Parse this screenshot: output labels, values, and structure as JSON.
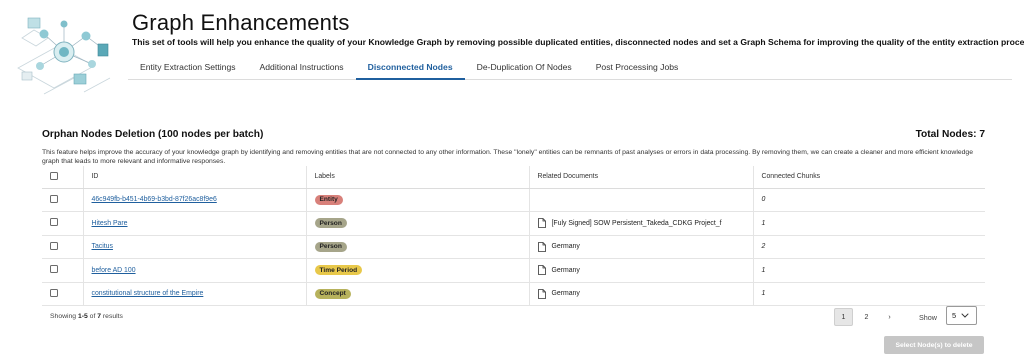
{
  "header": {
    "title": "Graph Enhancements",
    "subtitle": "This set of tools will help you enhance the quality of your Knowledge Graph by removing possible duplicated entities, disconnected nodes and set a Graph Schema for improving the quality of the entity extraction process"
  },
  "tabs": [
    {
      "label": "Entity Extraction Settings",
      "active": false
    },
    {
      "label": "Additional Instructions",
      "active": false
    },
    {
      "label": "Disconnected Nodes",
      "active": true
    },
    {
      "label": "De-Duplication Of Nodes",
      "active": false
    },
    {
      "label": "Post Processing Jobs",
      "active": false
    }
  ],
  "section": {
    "title": "Orphan Nodes Deletion (100 nodes per batch)",
    "total": "Total Nodes: 7",
    "description": "This feature helps improve the accuracy of your knowledge graph by identifying and removing entities that are not connected to any other information. These \"lonely\" entities can be remnants of past analyses or errors in data processing. By removing them, we can create a cleaner and more efficient knowledge graph that leads to more relevant and informative responses."
  },
  "table": {
    "headers": {
      "id": "ID",
      "labels": "Labels",
      "documents": "Related Documents",
      "chunks": "Connected Chunks"
    },
    "rows": [
      {
        "id": "46c949fb-b451-4b69-b3bd-87f26ac8f9e6",
        "label": "Entity",
        "label_color": "#d8807a",
        "document": "",
        "chunks": "0"
      },
      {
        "id": "Hitesh Pare",
        "label": "Person",
        "label_color": "#a6a58a",
        "document": "[Fuly Signed] SOW Persistent_Takeda_CDKG Project_f",
        "chunks": "1"
      },
      {
        "id": "Tacitus",
        "label": "Person",
        "label_color": "#a6a58a",
        "document": "Germany",
        "chunks": "2"
      },
      {
        "id": "before AD 100",
        "label": "Time Period",
        "label_color": "#e8c84a",
        "document": "Germany",
        "chunks": "1"
      },
      {
        "id": "constitutional structure of the Empire",
        "label": "Concept",
        "label_color": "#b7b25c",
        "document": "Germany",
        "chunks": "1"
      }
    ]
  },
  "footer": {
    "showing_prefix": "Showing ",
    "showing_range": "1-5",
    "showing_of": " of ",
    "showing_total": "7",
    "showing_suffix": " results",
    "pages": [
      "1",
      "2"
    ],
    "current_page": "1",
    "next": "›",
    "show_label": "Show",
    "page_size": "5",
    "delete_button": "Select Node(s) to delete"
  }
}
